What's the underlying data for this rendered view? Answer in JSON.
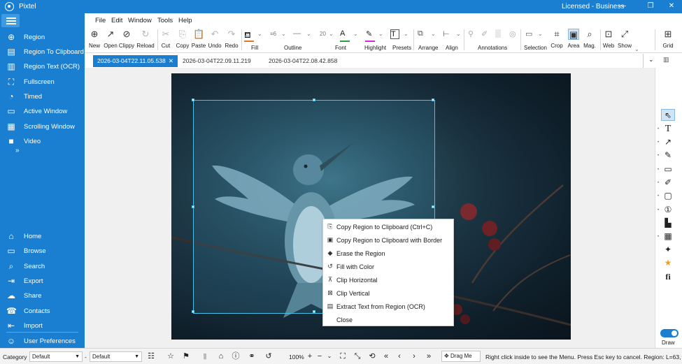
{
  "titlebar": {
    "app_title": "Pixtel",
    "license": "Licensed - Business",
    "minimize_label": "—",
    "restore_label": "❐",
    "close_label": "✕"
  },
  "sidebar": {
    "top_items": [
      {
        "label": "Region",
        "icon": "⊕"
      },
      {
        "label": "Region To Clipboard",
        "icon": "▤"
      },
      {
        "label": "Region Text (OCR)",
        "icon": "▥"
      },
      {
        "label": "Fullscreen",
        "icon": "⛶"
      },
      {
        "label": "Timed",
        "icon": "◔"
      },
      {
        "label": "Active Window",
        "icon": "▭"
      },
      {
        "label": "Scrolling Window",
        "icon": "▦"
      },
      {
        "label": "Video",
        "icon": "■"
      }
    ],
    "more_label": "»",
    "bottom_items": [
      {
        "label": "Home",
        "icon": "⌂"
      },
      {
        "label": "Browse",
        "icon": "▭"
      },
      {
        "label": "Search",
        "icon": "⌕"
      },
      {
        "label": "Export",
        "icon": "⇥"
      },
      {
        "label": "Share",
        "icon": "☁"
      },
      {
        "label": "Contacts",
        "icon": "☎"
      },
      {
        "label": "Import",
        "icon": "⇤"
      },
      {
        "label": "User Preferences",
        "icon": "☺"
      }
    ]
  },
  "menubar": {
    "items": [
      "File",
      "Edit",
      "Window",
      "Tools",
      "Help"
    ]
  },
  "ribbon": {
    "buttons": [
      {
        "label": "New",
        "icon": "⊕"
      },
      {
        "label": "Open",
        "icon": "↗"
      },
      {
        "label": "Clippy",
        "icon": "⊘"
      },
      {
        "label": "Reload",
        "icon": "↻"
      },
      {
        "label": "Cut",
        "icon": "✂"
      },
      {
        "label": "Copy",
        "icon": "⎘"
      },
      {
        "label": "Paste",
        "icon": "📋"
      },
      {
        "label": "Undo",
        "icon": "↶"
      },
      {
        "label": "Redo",
        "icon": "↷"
      }
    ],
    "groups": {
      "fill": "Fill",
      "outline": "Outline",
      "font": "Font",
      "highlight": "Highlight",
      "presets": "Presets",
      "arrange": "Arrange",
      "align": "Align",
      "annotations": "Annotations",
      "selection": "Selection",
      "crop": "Crop",
      "area": "Area",
      "mag": "Mag.",
      "web": "Web",
      "show": "Show",
      "grid": "Grid"
    },
    "outline_width": "6",
    "font_size": "20",
    "colors": {
      "fill": "#e87722",
      "font": "#2e9e3e",
      "highlight": "#d02ad0"
    }
  },
  "tabs": [
    {
      "label": "2026-03-04T22.11.05.538",
      "active": true,
      "close": "✕"
    },
    {
      "label": "2026-03-04T22.09.11.219",
      "active": false
    },
    {
      "label": "2026-03-04T22.08.42.858",
      "active": false
    }
  ],
  "context_menu": {
    "items": [
      {
        "label": "Copy Region to Clipboard (Ctrl+C)",
        "icon": "⎘"
      },
      {
        "label": "Copy Region to Clipboard with Border",
        "icon": "▣"
      },
      {
        "label": "Erase the Region",
        "icon": "◆"
      },
      {
        "label": "Fill with Color",
        "icon": "↺"
      },
      {
        "label": "Clip Horizontal",
        "icon": "⊼"
      },
      {
        "label": "Clip Vertical",
        "icon": "⊠"
      },
      {
        "label": "Extract Text from Region (OCR)",
        "icon": "▤"
      },
      {
        "label": "Close",
        "icon": ""
      }
    ]
  },
  "right_tools": {
    "draw_label": "Draw",
    "tools": [
      {
        "name": "pointer",
        "icon": "⇖"
      },
      {
        "name": "text",
        "icon": "T"
      },
      {
        "name": "arrow",
        "icon": "↗"
      },
      {
        "name": "pen",
        "icon": "✎"
      },
      {
        "name": "rectangle",
        "icon": "▭"
      },
      {
        "name": "marker",
        "icon": "✐"
      },
      {
        "name": "note",
        "icon": "▢"
      },
      {
        "name": "counter",
        "icon": "①"
      },
      {
        "name": "stamp",
        "icon": "▙"
      },
      {
        "name": "image",
        "icon": "▦"
      },
      {
        "name": "sparkle",
        "icon": "✦"
      },
      {
        "name": "star",
        "icon": "★"
      },
      {
        "name": "font",
        "icon": "fi"
      }
    ]
  },
  "statusbar": {
    "category_label": "Category",
    "category_value": "Default",
    "second_value": "Default",
    "zoom": "100%",
    "drag_label": "Drag Me",
    "message": "Right click inside to see the Menu. Press Esc key to cancel. Region: L=63, T="
  }
}
